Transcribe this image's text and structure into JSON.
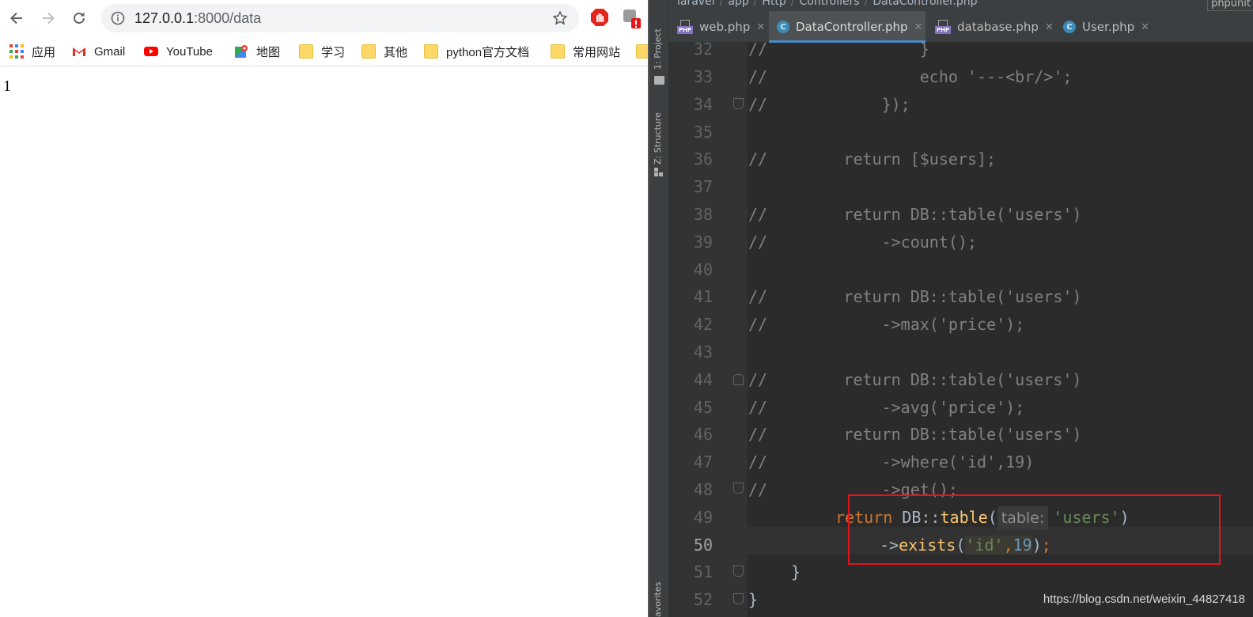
{
  "browser": {
    "url_host": "127.0.0.1",
    "url_path": ":8000/data",
    "bookmarks": [
      {
        "label": "应用",
        "icon": "apps-grid-icon"
      },
      {
        "label": "Gmail",
        "icon": "gmail-icon"
      },
      {
        "label": "YouTube",
        "icon": "youtube-icon"
      },
      {
        "label": "地图",
        "icon": "maps-icon"
      },
      {
        "label": "学习",
        "icon": "folder-icon"
      },
      {
        "label": "其他",
        "icon": "folder-icon"
      },
      {
        "label": "python官方文档",
        "icon": "folder-icon"
      },
      {
        "label": "常用网站",
        "icon": "folder-icon"
      }
    ],
    "page_output": "1"
  },
  "ide": {
    "breadcrumb": [
      "laravel",
      "app",
      "Http",
      "Controllers",
      "DataController.php"
    ],
    "run_config": "phpunit",
    "side_tabs": {
      "project": "1: Project",
      "structure": "Z: Structure",
      "favorites": "avorites"
    },
    "tabs": [
      {
        "label": "web.php",
        "icon": "php-file-icon",
        "active": false
      },
      {
        "label": "DataController.php",
        "icon": "class-icon",
        "active": true
      },
      {
        "label": "database.php",
        "icon": "php-file-icon",
        "active": false
      },
      {
        "label": "User.php",
        "icon": "class-icon",
        "active": false
      }
    ],
    "line_numbers": [
      "32",
      "33",
      "34",
      "35",
      "36",
      "37",
      "38",
      "39",
      "40",
      "41",
      "42",
      "43",
      "44",
      "45",
      "46",
      "47",
      "48",
      "49",
      "50",
      "51",
      "52"
    ],
    "current_line": "50",
    "code": {
      "l32": "//                }",
      "l33": "//                echo '---<br/>';",
      "l34": "//            });",
      "l36": "//        return [$users];",
      "l38": "//        return DB::table('users')",
      "l39": "//            ->count();",
      "l41": "//        return DB::table('users')",
      "l42": "//            ->max('price');",
      "l44": "//        return DB::table('users')",
      "l45": "//            ->avg('price');",
      "l46": "//        return DB::table('users')",
      "l47": "//            ->where('id',19)",
      "l48": "//            ->get();",
      "l49": {
        "kw": "return",
        "cls": "DB",
        "op": "::",
        "fn": "table",
        "open": "(",
        "hint": "table:",
        "arg": "'users'",
        "close": ")"
      },
      "l50": {
        "arrow": "->",
        "fn": "exists",
        "open": "(",
        "arg1": "'id'",
        "comma": ",",
        "arg2": "19",
        "close": ")",
        "semi": ";"
      },
      "l51": "}",
      "l52": "}"
    },
    "watermark": "https://blog.csdn.net/weixin_44827418"
  },
  "colors": {
    "comment": "#808080",
    "keyword": "#cc7832",
    "function": "#ffc66d",
    "string": "#6a8759",
    "number": "#6897bb",
    "highlight_box": "#e0151b"
  }
}
